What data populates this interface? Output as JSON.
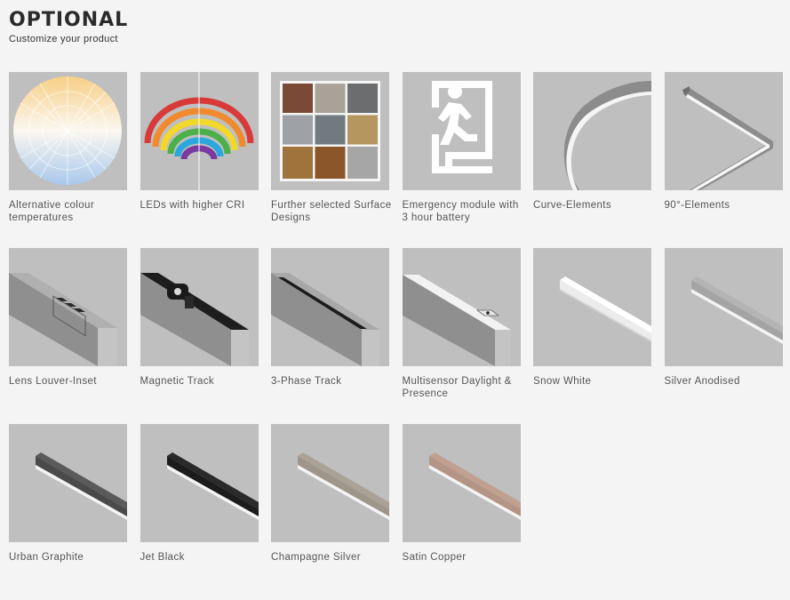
{
  "header": {
    "title": "OPTIONAL",
    "subtitle": "Customize your product"
  },
  "options": [
    {
      "label": "Alternative colour temperatures",
      "icon": "colour-temperature-wheel-icon"
    },
    {
      "label": "LEDs with higher CRI",
      "icon": "rainbow-cri-icon"
    },
    {
      "label": "Further selected Surface Designs",
      "icon": "surface-swatches-icon"
    },
    {
      "label": "Emergency module with 3 hour battery",
      "icon": "emergency-exit-icon"
    },
    {
      "label": "Curve-Elements",
      "icon": "curve-element-icon"
    },
    {
      "label": "90°-Elements",
      "icon": "angle-element-icon"
    },
    {
      "label": "Lens Louver-Inset",
      "icon": "lens-louver-profile-icon"
    },
    {
      "label": "Magnetic Track",
      "icon": "magnetic-track-profile-icon"
    },
    {
      "label": "3-Phase Track",
      "icon": "three-phase-track-profile-icon"
    },
    {
      "label": "Multisensor Daylight & Presence",
      "icon": "multisensor-profile-icon"
    },
    {
      "label": "Snow White",
      "icon": "snow-white-luminaire-icon"
    },
    {
      "label": "Silver Anodised",
      "icon": "silver-anodised-luminaire-icon"
    },
    {
      "label": "Urban Graphite",
      "icon": "urban-graphite-luminaire-icon"
    },
    {
      "label": "Jet Black",
      "icon": "jet-black-luminaire-icon"
    },
    {
      "label": "Champagne Silver",
      "icon": "champagne-silver-luminaire-icon"
    },
    {
      "label": "Satin Copper",
      "icon": "satin-copper-luminaire-icon"
    }
  ],
  "colors": {
    "thumb_bg": "#bfbfbf",
    "snow_white": "#f5f5f5",
    "silver_anodised": "#a8a8a8",
    "urban_graphite": "#4a4a4a",
    "jet_black": "#1c1c1c",
    "champagne_silver": "#9e968a",
    "satin_copper": "#b49484"
  }
}
